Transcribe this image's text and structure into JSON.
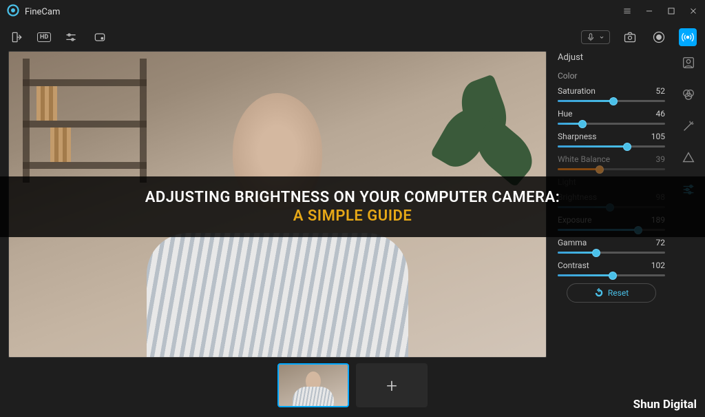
{
  "app": {
    "title": "FineCam"
  },
  "toolbar": {
    "hd_label": "HD"
  },
  "adjust": {
    "title": "Adjust",
    "section_color": "Color",
    "section_light": "Light",
    "sliders": {
      "saturation": {
        "label": "Saturation",
        "value": 52,
        "percent": 52
      },
      "hue": {
        "label": "Hue",
        "value": 46,
        "percent": 23
      },
      "sharpness": {
        "label": "Sharpness",
        "value": 105,
        "percent": 65
      },
      "white_balance": {
        "label": "White Balance",
        "value": 39,
        "percent": 39
      },
      "brightness": {
        "label": "Brightness",
        "value": 98,
        "percent": 49
      },
      "exposure": {
        "label": "Exposure",
        "value": 189,
        "percent": 75
      },
      "gamma": {
        "label": "Gamma",
        "value": 72,
        "percent": 36
      },
      "contrast": {
        "label": "Contrast",
        "value": 102,
        "percent": 51
      }
    },
    "reset_label": "Reset"
  },
  "thumbs": {
    "add_label": "+"
  },
  "overlay": {
    "line1": "ADJUSTING BRIGHTNESS ON YOUR COMPUTER CAMERA:",
    "line2": "A SIMPLE GUIDE"
  },
  "watermark": "Shun Digital"
}
